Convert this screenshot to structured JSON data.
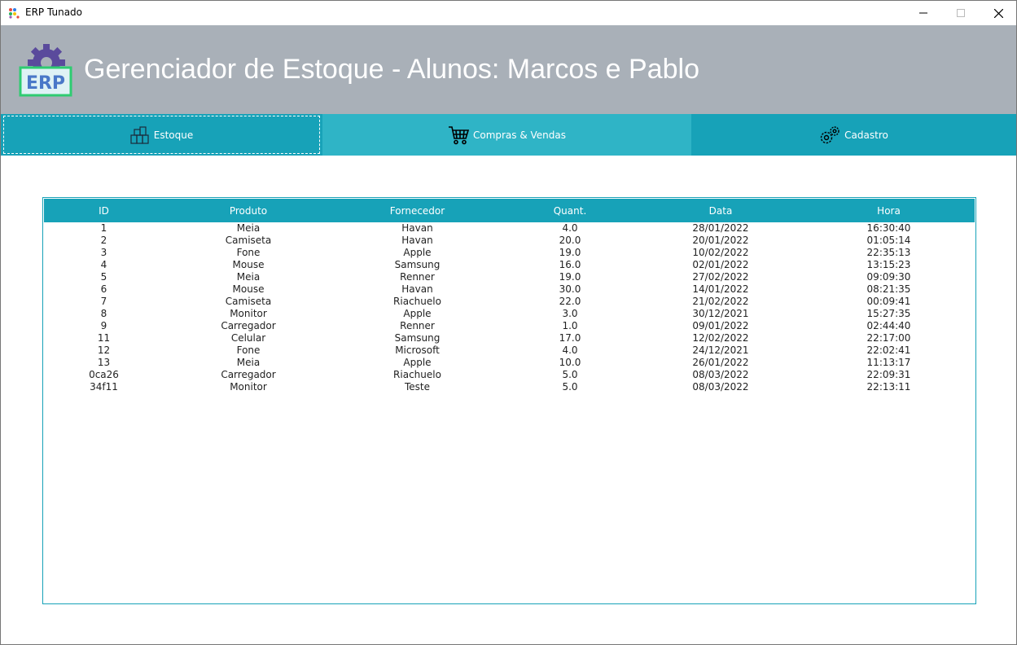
{
  "window": {
    "title": "ERP Tunado"
  },
  "header": {
    "title": "Gerenciador de Estoque - Alunos: Marcos e Pablo",
    "logo_text": "ERP"
  },
  "nav": {
    "tabs": [
      {
        "label": "Estoque",
        "icon": "boxes-icon"
      },
      {
        "label": "Compras & Vendas",
        "icon": "cart-icon"
      },
      {
        "label": "Cadastro",
        "icon": "gears-icon"
      }
    ]
  },
  "table": {
    "columns": [
      "ID",
      "Produto",
      "Fornecedor",
      "Quant.",
      "Data",
      "Hora"
    ],
    "rows": [
      [
        "1",
        "Meia",
        "Havan",
        "4.0",
        "28/01/2022",
        "16:30:40"
      ],
      [
        "2",
        "Camiseta",
        "Havan",
        "20.0",
        "20/01/2022",
        "01:05:14"
      ],
      [
        "3",
        "Fone",
        "Apple",
        "19.0",
        "10/02/2022",
        "22:35:13"
      ],
      [
        "4",
        "Mouse",
        "Samsung",
        "16.0",
        "02/01/2022",
        "13:15:23"
      ],
      [
        "5",
        "Meia",
        "Renner",
        "19.0",
        "27/02/2022",
        "09:09:30"
      ],
      [
        "6",
        "Mouse",
        "Havan",
        "30.0",
        "14/01/2022",
        "08:21:35"
      ],
      [
        "7",
        "Camiseta",
        "Riachuelo",
        "22.0",
        "21/02/2022",
        "00:09:41"
      ],
      [
        "8",
        "Monitor",
        "Apple",
        "3.0",
        "30/12/2021",
        "15:27:35"
      ],
      [
        "9",
        "Carregador",
        "Renner",
        "1.0",
        "09/01/2022",
        "02:44:40"
      ],
      [
        "11",
        "Celular",
        "Samsung",
        "17.0",
        "12/02/2022",
        "22:17:00"
      ],
      [
        "12",
        "Fone",
        "Microsoft",
        "4.0",
        "24/12/2021",
        "22:02:41"
      ],
      [
        "13",
        "Meia",
        "Apple",
        "10.0",
        "26/01/2022",
        "11:13:17"
      ],
      [
        "0ca26",
        "Carregador",
        "Riachuelo",
        "5.0",
        "08/03/2022",
        "22:09:31"
      ],
      [
        "34f11",
        "Monitor",
        "Teste",
        "5.0",
        "08/03/2022",
        "22:13:11"
      ]
    ]
  },
  "colors": {
    "accent": "#17a2b8",
    "accent_hover": "#2fb4c6",
    "header_bg": "#a9b0b8"
  }
}
